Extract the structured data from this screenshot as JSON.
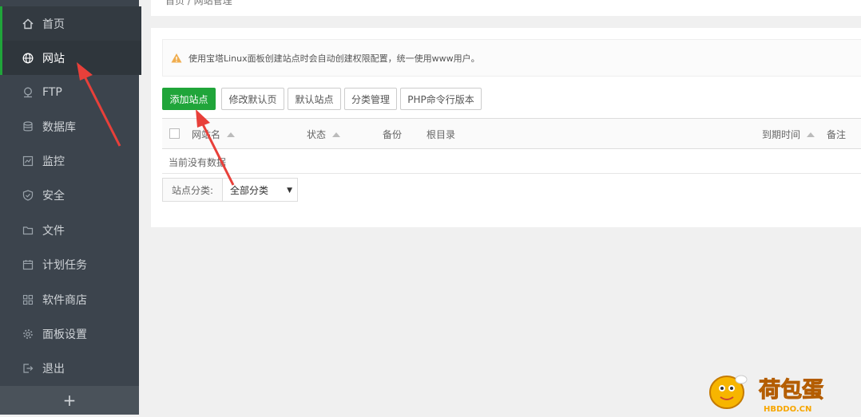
{
  "sidebar": {
    "items": [
      {
        "label": "首页",
        "icon": "home-icon"
      },
      {
        "label": "网站",
        "icon": "globe-icon"
      },
      {
        "label": "FTP",
        "icon": "ftp-icon"
      },
      {
        "label": "数据库",
        "icon": "database-icon"
      },
      {
        "label": "监控",
        "icon": "monitor-icon"
      },
      {
        "label": "安全",
        "icon": "shield-icon"
      },
      {
        "label": "文件",
        "icon": "folder-icon"
      },
      {
        "label": "计划任务",
        "icon": "calendar-icon"
      },
      {
        "label": "软件商店",
        "icon": "grid-icon"
      },
      {
        "label": "面板设置",
        "icon": "gear-icon"
      },
      {
        "label": "退出",
        "icon": "logout-icon"
      }
    ],
    "active": "网站",
    "add_label": "+"
  },
  "breadcrumb": "首页 / 网站管理",
  "notice": "使用宝塔Linux面板创建站点时会自动创建权限配置，统一使用www用户。",
  "toolbar": {
    "add_site": "添加站点",
    "edit_default_page": "修改默认页",
    "default_site": "默认站点",
    "category_manage": "分类管理",
    "php_cli_version": "PHP命令行版本"
  },
  "table": {
    "headers": {
      "site_name": "网站名",
      "status": "状态",
      "backup": "备份",
      "root_dir": "根目录",
      "expire": "到期时间",
      "note": "备注"
    },
    "empty_text": "当前没有数据"
  },
  "filter": {
    "label": "站点分类:",
    "selected": "全部分类"
  },
  "watermark": {
    "text": "荷包蛋",
    "subtext": "HBDDO.CN"
  },
  "colors": {
    "sidebar_bg": "#3c444d",
    "accent_green": "#20a53a",
    "arrow_red": "#e8403a"
  }
}
